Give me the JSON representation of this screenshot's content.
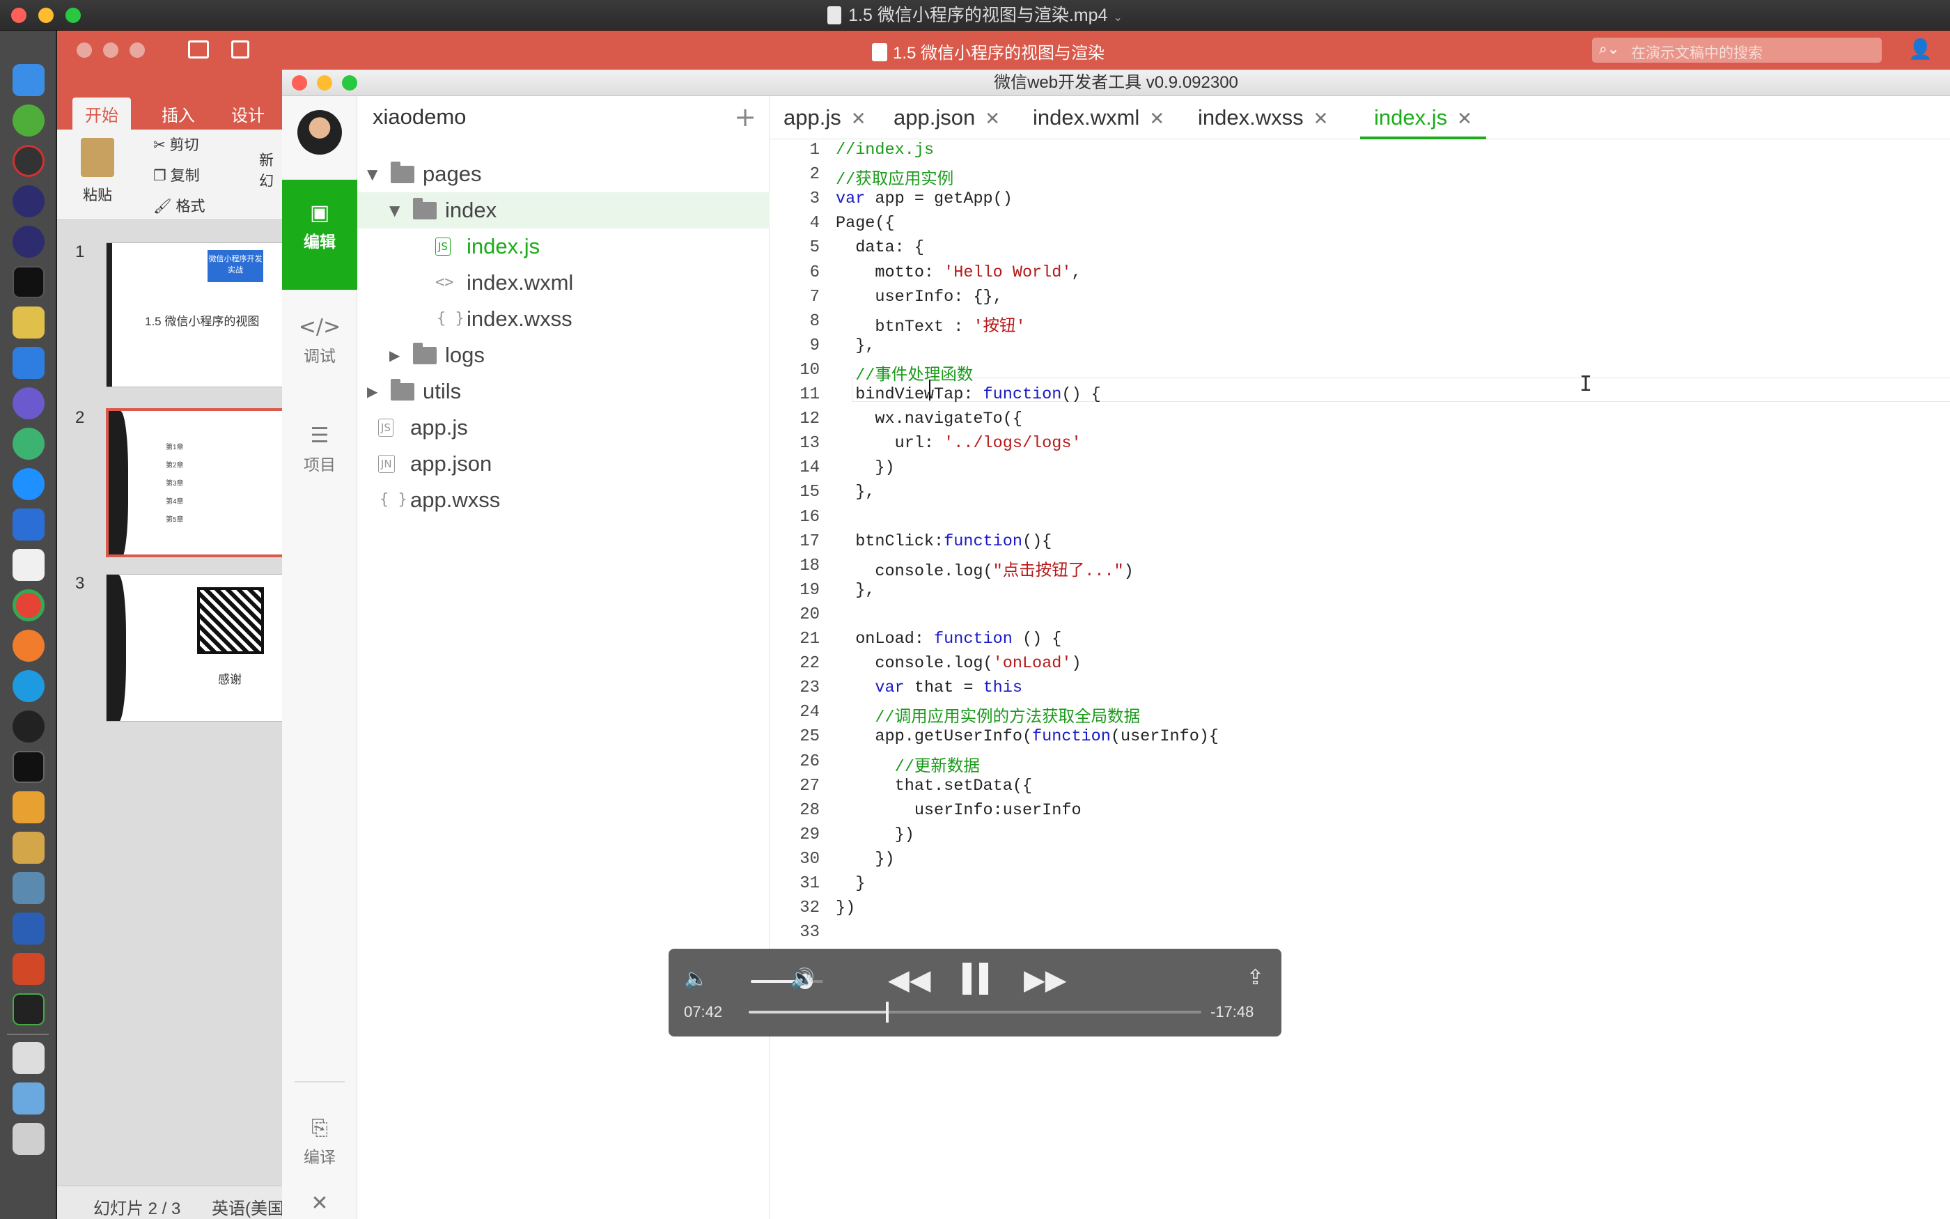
{
  "player": {
    "title": "1.5 微信小程序的视图与渲染.mp4",
    "elapsed": "07:42",
    "remaining": "-17:48",
    "progress": 0.306,
    "volume": 0.75
  },
  "ppt": {
    "doc_title": "1.5 微信小程序的视图与渲染",
    "search_placeholder": "在演示文稿中的搜索",
    "tabs": [
      "开始",
      "插入",
      "设计"
    ],
    "ribbon": {
      "paste": "粘贴",
      "cut": "剪切",
      "copy": "复制",
      "format": "格式",
      "new": "新",
      "slide": "幻"
    },
    "slides": [
      {
        "num": "1",
        "badge": "微信小程序开发实战",
        "title": "1.5 微信小程序的视图"
      },
      {
        "num": "2",
        "rows": [
          "第1章",
          "第2章",
          "第3章",
          "第4章",
          "第5章"
        ]
      },
      {
        "num": "3",
        "caption": "感谢"
      }
    ],
    "status_slide": "幻灯片 2 / 3",
    "status_lang": "英语(美国"
  },
  "ide": {
    "title": "微信web开发者工具 v0.9.092300",
    "side": {
      "edit": "编辑",
      "debug": "调试",
      "project": "项目",
      "compile": "编译",
      "close": "关闭"
    },
    "project_name": "xiaodemo",
    "tree": {
      "pages": "pages",
      "index": "index",
      "index_js": "index.js",
      "index_wxml": "index.wxml",
      "index_wxss": "index.wxss",
      "logs": "logs",
      "utils": "utils",
      "app_js": "app.js",
      "app_json": "app.json",
      "app_wxss": "app.wxss",
      "tag_js": "JS",
      "tag_json": "JN"
    },
    "tabs": [
      "app.js",
      "app.json",
      "index.wxml",
      "index.wxss",
      "index.js"
    ],
    "active_tab": "index.js"
  },
  "code": [
    [
      [
        "c",
        "//index.js"
      ]
    ],
    [
      [
        "c",
        "//获取应用实例"
      ]
    ],
    [
      [
        "k",
        "var"
      ],
      [
        "t",
        " app = getApp()"
      ]
    ],
    [
      [
        "t",
        "Page({"
      ]
    ],
    [
      [
        "t",
        "  data: {"
      ]
    ],
    [
      [
        "t",
        "    motto: "
      ],
      [
        "s",
        "'Hello World'"
      ],
      [
        "t",
        ","
      ]
    ],
    [
      [
        "t",
        "    userInfo: {},"
      ]
    ],
    [
      [
        "t",
        "    btnText : "
      ],
      [
        "s",
        "'按钮'"
      ]
    ],
    [
      [
        "t",
        "  },"
      ]
    ],
    [
      [
        "t",
        "  "
      ],
      [
        "c",
        "//事件处理函数"
      ]
    ],
    [
      [
        "t",
        "  bindViewTap: "
      ],
      [
        "k",
        "function"
      ],
      [
        "t",
        "() {"
      ]
    ],
    [
      [
        "t",
        "    wx.navigateTo({"
      ]
    ],
    [
      [
        "t",
        "      url: "
      ],
      [
        "s",
        "'../logs/logs'"
      ]
    ],
    [
      [
        "t",
        "    })"
      ]
    ],
    [
      [
        "t",
        "  },"
      ]
    ],
    [],
    [
      [
        "t",
        "  btnClick:"
      ],
      [
        "k",
        "function"
      ],
      [
        "t",
        "(){"
      ]
    ],
    [
      [
        "t",
        "    console.log("
      ],
      [
        "s",
        "\"点击按钮了...\""
      ],
      [
        "t",
        ")"
      ]
    ],
    [
      [
        "t",
        "  },"
      ]
    ],
    [],
    [
      [
        "t",
        "  onLoad: "
      ],
      [
        "k",
        "function"
      ],
      [
        "t",
        " () {"
      ]
    ],
    [
      [
        "t",
        "    console.log("
      ],
      [
        "s",
        "'onLoad'"
      ],
      [
        "t",
        ")"
      ]
    ],
    [
      [
        "t",
        "    "
      ],
      [
        "k",
        "var"
      ],
      [
        "t",
        " that = "
      ],
      [
        "k",
        "this"
      ]
    ],
    [
      [
        "t",
        "    "
      ],
      [
        "c",
        "//调用应用实例的方法获取全局数据"
      ]
    ],
    [
      [
        "t",
        "    app.getUserInfo("
      ],
      [
        "k",
        "function"
      ],
      [
        "t",
        "(userInfo){"
      ]
    ],
    [
      [
        "t",
        "      "
      ],
      [
        "c",
        "//更新数据"
      ]
    ],
    [
      [
        "t",
        "      that.setData({"
      ]
    ],
    [
      [
        "t",
        "        userInfo:userInfo"
      ]
    ],
    [
      [
        "t",
        "      })"
      ]
    ],
    [
      [
        "t",
        "    })"
      ]
    ],
    [
      [
        "t",
        "  }"
      ]
    ],
    [
      [
        "t",
        "})"
      ]
    ],
    []
  ]
}
